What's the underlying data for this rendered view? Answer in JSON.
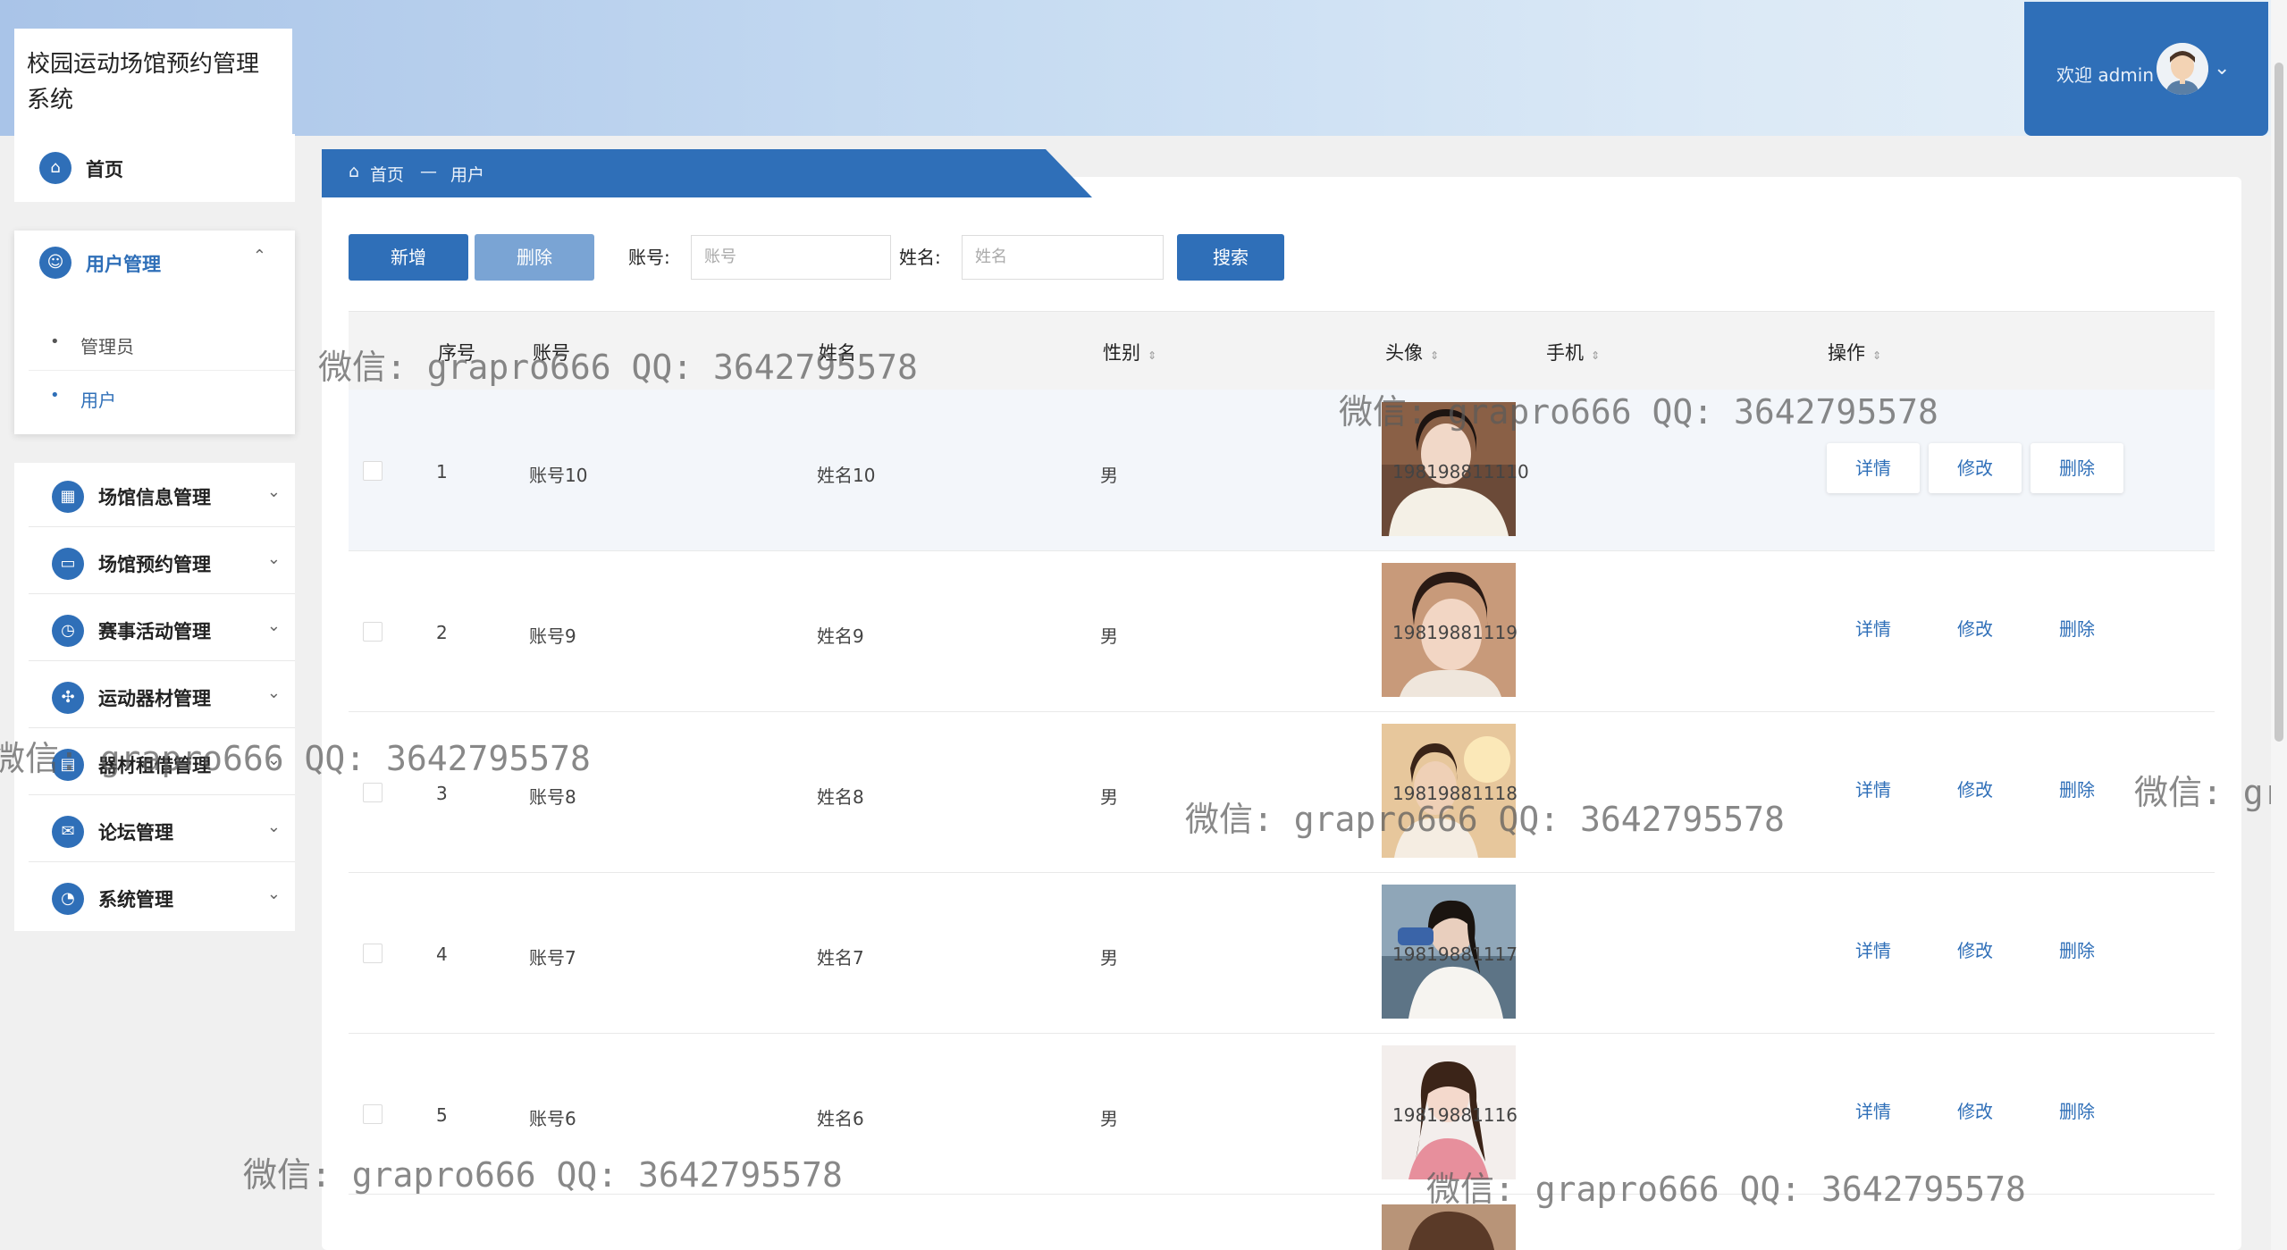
{
  "header": {
    "app_title": "校园运动场馆预约管理系统",
    "welcome_text": "欢迎 admin"
  },
  "sidebar": {
    "home": "首页",
    "user_mgmt": {
      "label": "用户管理",
      "children": [
        "管理员",
        "用户"
      ]
    },
    "menus": [
      "场馆信息管理",
      "场馆预约管理",
      "赛事活动管理",
      "运动器材管理",
      "器材租借管理",
      "论坛管理",
      "系统管理"
    ]
  },
  "breadcrumb": {
    "home": "首页",
    "separator": "—",
    "current": "用户"
  },
  "toolbar": {
    "add": "新增",
    "delete": "删除",
    "account_label": "账号:",
    "account_placeholder": "账号",
    "name_label": "姓名:",
    "name_placeholder": "姓名",
    "search": "搜索"
  },
  "table": {
    "columns": [
      "序号",
      "账号",
      "姓名",
      "性别",
      "头像",
      "手机",
      "操作"
    ],
    "rows": [
      {
        "index": "1",
        "account": "账号10",
        "name": "姓名10",
        "gender": "男",
        "phone": "198198811110"
      },
      {
        "index": "2",
        "account": "账号9",
        "name": "姓名9",
        "gender": "男",
        "phone": "19819881119"
      },
      {
        "index": "3",
        "account": "账号8",
        "name": "姓名8",
        "gender": "男",
        "phone": "19819881118"
      },
      {
        "index": "4",
        "account": "账号7",
        "name": "姓名7",
        "gender": "男",
        "phone": "19819881117"
      },
      {
        "index": "5",
        "account": "账号6",
        "name": "姓名6",
        "gender": "男",
        "phone": "19819881116"
      }
    ],
    "actions": [
      "详情",
      "修改",
      "删除"
    ]
  },
  "watermark": "微信: grapro666 QQ: 3642795578",
  "watermark_partial_left": "微信: grapro666 QQ: 3642795578",
  "watermark_partial_right": "微信: gra",
  "colors": {
    "primary": "#2f6fb8",
    "delete_button": "#7aa4d4",
    "header_gradient_start": "#a9c4e8",
    "header_gradient_end": "#e6f0f8"
  }
}
